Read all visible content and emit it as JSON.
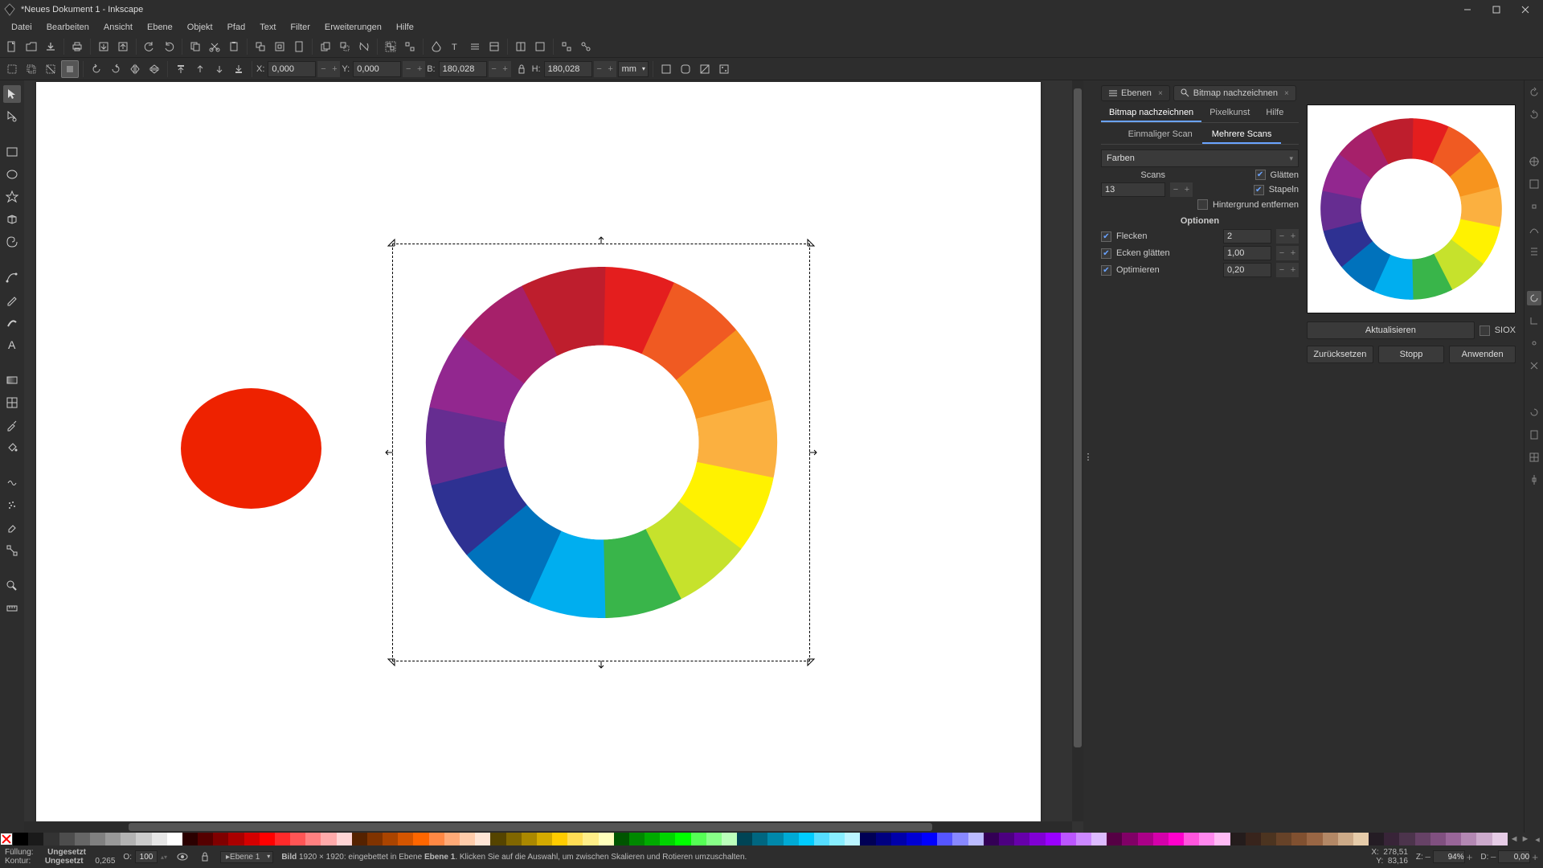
{
  "title": "*Neues Dokument 1 - Inkscape",
  "menu": [
    "Datei",
    "Bearbeiten",
    "Ansicht",
    "Ebene",
    "Objekt",
    "Pfad",
    "Text",
    "Filter",
    "Erweiterungen",
    "Hilfe"
  ],
  "coords": {
    "x_label": "X:",
    "x": "0,000",
    "y_label": "Y:",
    "y": "0,000",
    "w_label": "B:",
    "w": "180,028",
    "h_label": "H:",
    "h": "180,028",
    "units": "mm"
  },
  "panel": {
    "tabs": {
      "layers": "Ebenen",
      "trace": "Bitmap nachzeichnen"
    },
    "subtabs": {
      "trace": "Bitmap nachzeichnen",
      "pixel": "Pixelkunst",
      "help": "Hilfe"
    },
    "scantabs": {
      "single": "Einmaliger Scan",
      "multi": "Mehrere Scans"
    },
    "mode": "Farben",
    "scans_label": "Scans",
    "scans": "13",
    "glaetten": "Glätten",
    "stapeln": "Stapeln",
    "hg_entfernen": "Hintergrund entfernen",
    "optionen": "Optionen",
    "flecken_label": "Flecken",
    "flecken": "2",
    "ecken_label": "Ecken glätten",
    "ecken": "1,00",
    "optimieren_label": "Optimieren",
    "optimieren": "0,20",
    "aktualisieren": "Aktualisieren",
    "siox": "SIOX",
    "reset": "Zurücksetzen",
    "stop": "Stopp",
    "apply": "Anwenden"
  },
  "status": {
    "fill_label": "Füllung:",
    "fill_value": "Ungesetzt",
    "stroke_label": "Kontur:",
    "stroke_value": "Ungesetzt",
    "stroke_w": "0,265",
    "opacity_label": "O:",
    "opacity": "100",
    "layer": "Ebene 1",
    "msg_prefix": "Bild",
    "msg_dims": "1920 × 1920: eingebettet in Ebene ",
    "msg_bold": "Ebene 1",
    "msg_suffix": ". Klicken Sie auf die Auswahl, um zwischen Skalieren und Rotieren umzuschalten.",
    "x_label": "X:",
    "x": "278,51",
    "y_label": "Y:",
    "y": "83,16",
    "z_label": "Z:",
    "zoom": "94%",
    "d_label": "D:",
    "rot": "0,00"
  },
  "wheel_colors": [
    "#e53935",
    "#f4511e",
    "#fb8c00",
    "#ffb300",
    "#fdd835",
    "#ece244",
    "#c0ca33",
    "#7cb342",
    "#43a047",
    "#26a69a",
    "#29b6f6",
    "#1e88e5",
    "#3949ab",
    "#5e35b1",
    "#8e24aa",
    "#ad1457",
    "#c2185b",
    "#d32f2f"
  ],
  "wheel12": [
    "#e41e1e",
    "#f05a22",
    "#f7941e",
    "#fbb040",
    "#fff200",
    "#c6e22c",
    "#39b54a",
    "#00aeef",
    "#0072bc",
    "#2e3192",
    "#662d91",
    "#92278f",
    "#a6206a",
    "#be1e2d"
  ],
  "palette": [
    "#000000",
    "#1a1a1a",
    "#333333",
    "#4d4d4d",
    "#666666",
    "#808080",
    "#999999",
    "#b3b3b3",
    "#cccccc",
    "#e6e6e6",
    "#ffffff",
    "#2b0000",
    "#550000",
    "#800000",
    "#aa0000",
    "#d40000",
    "#ff0000",
    "#ff2a2a",
    "#ff5555",
    "#ff8080",
    "#ffaaaa",
    "#ffd5d5",
    "#552200",
    "#803300",
    "#aa4400",
    "#d45500",
    "#ff6600",
    "#ff8844",
    "#ffaa77",
    "#ffccaa",
    "#ffe5d5",
    "#554400",
    "#806600",
    "#aa8800",
    "#d4aa00",
    "#ffcc00",
    "#ffdd55",
    "#ffee88",
    "#ffffbb",
    "#005500",
    "#008800",
    "#00aa00",
    "#00d400",
    "#00ff00",
    "#55ff55",
    "#88ff88",
    "#bbffbb",
    "#004455",
    "#006680",
    "#0088aa",
    "#00aad4",
    "#00ccff",
    "#55ddff",
    "#88eeff",
    "#bbf5ff",
    "#000055",
    "#000080",
    "#0000aa",
    "#0000d4",
    "#0000ff",
    "#5555ff",
    "#8888ff",
    "#bbbbff",
    "#330055",
    "#4c0080",
    "#6600aa",
    "#8000d4",
    "#9900ff",
    "#bb55ff",
    "#cc88ff",
    "#ddbbff",
    "#550044",
    "#800066",
    "#aa0088",
    "#d400aa",
    "#ff00cc",
    "#ff55dd",
    "#ff88ee",
    "#ffbbf5",
    "#241c1c",
    "#38241c",
    "#4c3420",
    "#664228",
    "#805030",
    "#996644",
    "#b38866",
    "#ccaa88",
    "#e6ccaa",
    "#241c24",
    "#382438",
    "#4c344c",
    "#664266",
    "#805080",
    "#996699",
    "#b388b3",
    "#ccaacc",
    "#e6cce6"
  ]
}
